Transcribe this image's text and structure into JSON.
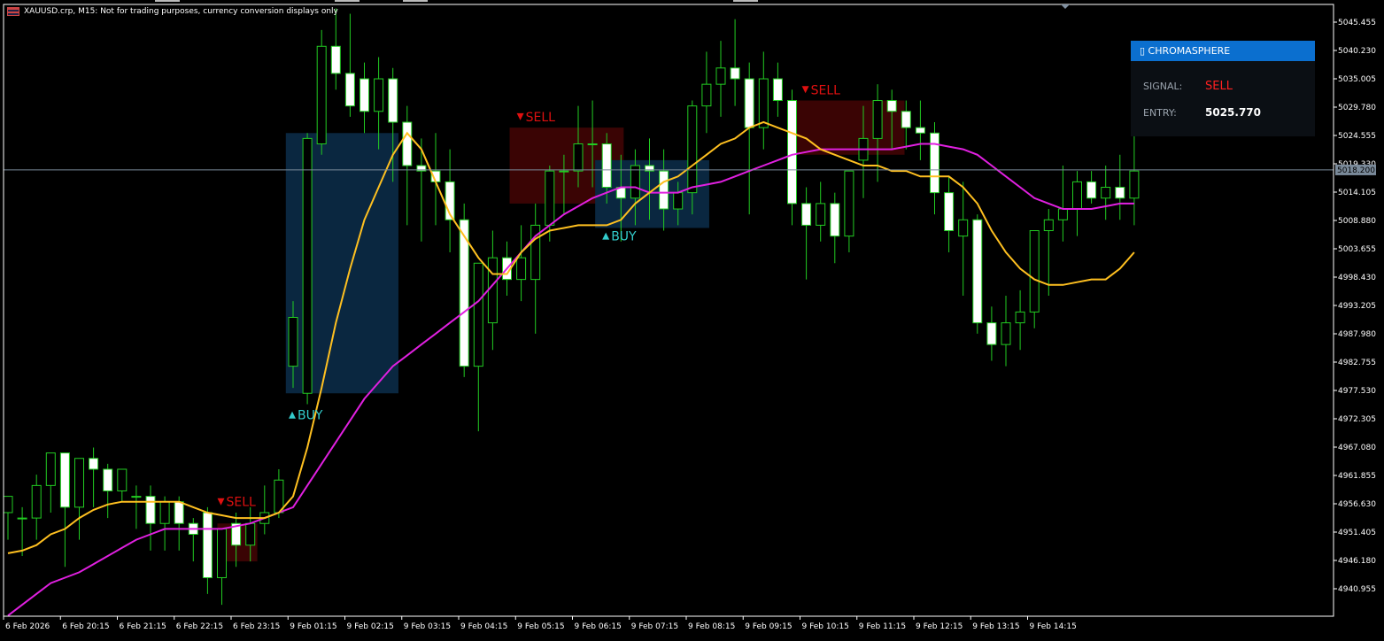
{
  "header": {
    "symbol_info": "XAUUSD.crp, M15:  Not for trading purposes, currency conversion displays only"
  },
  "panel": {
    "title": "▯ CHROMASPHERE",
    "signal_label": "SIGNAL:",
    "signal_value": "SELL",
    "entry_label": "ENTRY:",
    "entry_value": "5025.770"
  },
  "price_axis": [
    "5045.455",
    "5040.230",
    "5035.005",
    "5029.780",
    "5024.555",
    "5019.330",
    "5014.105",
    "5008.880",
    "5003.655",
    "4998.430",
    "4993.205",
    "4987.980",
    "4982.755",
    "4977.530",
    "4972.305",
    "4967.080",
    "4961.855",
    "4956.630",
    "4951.405",
    "4946.180",
    "4940.955"
  ],
  "current_price": "5018.200",
  "time_axis": [
    "6 Feb 2026",
    "6 Feb 20:15",
    "6 Feb 21:15",
    "6 Feb 22:15",
    "6 Feb 23:15",
    "9 Feb 01:15",
    "9 Feb 02:15",
    "9 Feb 03:15",
    "9 Feb 04:15",
    "9 Feb 05:15",
    "9 Feb 06:15",
    "9 Feb 07:15",
    "9 Feb 08:15",
    "9 Feb 09:15",
    "9 Feb 10:15",
    "9 Feb 11:15",
    "9 Feb 12:15",
    "9 Feb 13:15",
    "9 Feb 14:15"
  ],
  "signals": [
    {
      "type": "SELL",
      "label": "SELL"
    },
    {
      "type": "BUY",
      "label": "BUY"
    },
    {
      "type": "SELL",
      "label": "SELL"
    },
    {
      "type": "BUY",
      "label": "BUY"
    },
    {
      "type": "SELL",
      "label": "SELL"
    }
  ],
  "colors": {
    "bull_candle": "#000000",
    "bear_candle": "#ffffff",
    "wick": "#22cc22",
    "fast_ma": "#ffc020",
    "slow_ma": "#e020e0",
    "buy": "#33cccc",
    "sell": "#e01010",
    "buy_zone": "#0a2740",
    "sell_zone": "#3a0404"
  },
  "chart_data": {
    "type": "candlestick",
    "symbol": "XAUUSD.crp",
    "timeframe": "M15",
    "ylim": [
      4936,
      5049
    ],
    "candles": [
      {
        "o": 4955,
        "h": 4958,
        "l": 4950,
        "c": 4958
      },
      {
        "o": 4954,
        "h": 4956,
        "l": 4947,
        "c": 4954
      },
      {
        "o": 4954,
        "h": 4962,
        "l": 4950,
        "c": 4960
      },
      {
        "o": 4960,
        "h": 4966,
        "l": 4955,
        "c": 4966
      },
      {
        "o": 4966,
        "h": 4966,
        "l": 4945,
        "c": 4956
      },
      {
        "o": 4956,
        "h": 4965,
        "l": 4950,
        "c": 4965
      },
      {
        "o": 4965,
        "h": 4967,
        "l": 4956,
        "c": 4963
      },
      {
        "o": 4963,
        "h": 4964,
        "l": 4954,
        "c": 4959
      },
      {
        "o": 4959,
        "h": 4963,
        "l": 4957,
        "c": 4963
      },
      {
        "o": 4958,
        "h": 4960,
        "l": 4952,
        "c": 4958
      },
      {
        "o": 4958,
        "h": 4960,
        "l": 4948,
        "c": 4953
      },
      {
        "o": 4953,
        "h": 4958,
        "l": 4948,
        "c": 4957
      },
      {
        "o": 4957,
        "h": 4958,
        "l": 4948,
        "c": 4953
      },
      {
        "o": 4953,
        "h": 4954,
        "l": 4946,
        "c": 4951
      },
      {
        "o": 4955,
        "h": 4956,
        "l": 4940,
        "c": 4943
      },
      {
        "o": 4943,
        "h": 4950,
        "l": 4938,
        "c": 4952
      },
      {
        "o": 4953,
        "h": 4955,
        "l": 4945,
        "c": 4949
      },
      {
        "o": 4949,
        "h": 4956,
        "l": 4946,
        "c": 4953
      },
      {
        "o": 4953,
        "h": 4960,
        "l": 4951,
        "c": 4955
      },
      {
        "o": 4955,
        "h": 4963,
        "l": 4954,
        "c": 4961
      },
      {
        "o": 4982,
        "h": 4994,
        "l": 4978,
        "c": 4991
      },
      {
        "o": 4977,
        "h": 5025,
        "l": 4975,
        "c": 5024
      },
      {
        "o": 5023,
        "h": 5044,
        "l": 5021,
        "c": 5041
      },
      {
        "o": 5041,
        "h": 5048,
        "l": 5033,
        "c": 5036
      },
      {
        "o": 5036,
        "h": 5047,
        "l": 5028,
        "c": 5030
      },
      {
        "o": 5035,
        "h": 5038,
        "l": 5025,
        "c": 5029
      },
      {
        "o": 5029,
        "h": 5039,
        "l": 5022,
        "c": 5035
      },
      {
        "o": 5035,
        "h": 5037,
        "l": 5016,
        "c": 5027
      },
      {
        "o": 5027,
        "h": 5030,
        "l": 5008,
        "c": 5019
      },
      {
        "o": 5019,
        "h": 5024,
        "l": 5005,
        "c": 5018
      },
      {
        "o": 5018,
        "h": 5025,
        "l": 5008,
        "c": 5016
      },
      {
        "o": 5016,
        "h": 5022,
        "l": 5003,
        "c": 5009
      },
      {
        "o": 5009,
        "h": 5012,
        "l": 4980,
        "c": 4982
      },
      {
        "o": 4982,
        "h": 5001,
        "l": 4970,
        "c": 5001
      },
      {
        "o": 4990,
        "h": 5007,
        "l": 4985,
        "c": 5002
      },
      {
        "o": 5002,
        "h": 5005,
        "l": 4995,
        "c": 4998
      },
      {
        "o": 4998,
        "h": 5008,
        "l": 4994,
        "c": 5002
      },
      {
        "o": 4998,
        "h": 5012,
        "l": 4988,
        "c": 5008
      },
      {
        "o": 5008,
        "h": 5019,
        "l": 5005,
        "c": 5018
      },
      {
        "o": 5018,
        "h": 5021,
        "l": 5010,
        "c": 5018
      },
      {
        "o": 5018,
        "h": 5030,
        "l": 5015,
        "c": 5023
      },
      {
        "o": 5023,
        "h": 5031,
        "l": 5015,
        "c": 5023
      },
      {
        "o": 5023,
        "h": 5025,
        "l": 5012,
        "c": 5015
      },
      {
        "o": 5015,
        "h": 5021,
        "l": 5005,
        "c": 5013
      },
      {
        "o": 5013,
        "h": 5022,
        "l": 5008,
        "c": 5019
      },
      {
        "o": 5019,
        "h": 5024,
        "l": 5009,
        "c": 5018
      },
      {
        "o": 5018,
        "h": 5022,
        "l": 5007,
        "c": 5011
      },
      {
        "o": 5011,
        "h": 5016,
        "l": 5008,
        "c": 5014
      },
      {
        "o": 5014,
        "h": 5031,
        "l": 5010,
        "c": 5030
      },
      {
        "o": 5030,
        "h": 5040,
        "l": 5025,
        "c": 5034
      },
      {
        "o": 5034,
        "h": 5042,
        "l": 5028,
        "c": 5037
      },
      {
        "o": 5037,
        "h": 5046,
        "l": 5030,
        "c": 5035
      },
      {
        "o": 5035,
        "h": 5038,
        "l": 5010,
        "c": 5026
      },
      {
        "o": 5026,
        "h": 5040,
        "l": 5022,
        "c": 5035
      },
      {
        "o": 5035,
        "h": 5038,
        "l": 5028,
        "c": 5031
      },
      {
        "o": 5031,
        "h": 5033,
        "l": 5008,
        "c": 5012
      },
      {
        "o": 5012,
        "h": 5015,
        "l": 4998,
        "c": 5008
      },
      {
        "o": 5008,
        "h": 5016,
        "l": 5005,
        "c": 5012
      },
      {
        "o": 5012,
        "h": 5014,
        "l": 5001,
        "c": 5006
      },
      {
        "o": 5006,
        "h": 5018,
        "l": 5003,
        "c": 5018
      },
      {
        "o": 5020,
        "h": 5030,
        "l": 5013,
        "c": 5024
      },
      {
        "o": 5024,
        "h": 5034,
        "l": 5016,
        "c": 5031
      },
      {
        "o": 5031,
        "h": 5033,
        "l": 5022,
        "c": 5029
      },
      {
        "o": 5029,
        "h": 5031,
        "l": 5022,
        "c": 5026
      },
      {
        "o": 5026,
        "h": 5031,
        "l": 5020,
        "c": 5025
      },
      {
        "o": 5025,
        "h": 5027,
        "l": 5010,
        "c": 5014
      },
      {
        "o": 5014,
        "h": 5017,
        "l": 5003,
        "c": 5007
      },
      {
        "o": 5006,
        "h": 5016,
        "l": 4995,
        "c": 5009
      },
      {
        "o": 5009,
        "h": 5010,
        "l": 4988,
        "c": 4990
      },
      {
        "o": 4990,
        "h": 4993,
        "l": 4983,
        "c": 4986
      },
      {
        "o": 4986,
        "h": 4995,
        "l": 4982,
        "c": 4990
      },
      {
        "o": 4990,
        "h": 4996,
        "l": 4985,
        "c": 4992
      },
      {
        "o": 4992,
        "h": 5004,
        "l": 4989,
        "c": 5007
      },
      {
        "o": 5007,
        "h": 5011,
        "l": 4995,
        "c": 5009
      },
      {
        "o": 5009,
        "h": 5019,
        "l": 5005,
        "c": 5011
      },
      {
        "o": 5011,
        "h": 5018,
        "l": 5006,
        "c": 5016
      },
      {
        "o": 5016,
        "h": 5018,
        "l": 5012,
        "c": 5013
      },
      {
        "o": 5013,
        "h": 5019,
        "l": 5009,
        "c": 5015
      },
      {
        "o": 5015,
        "h": 5021,
        "l": 5009,
        "c": 5013
      },
      {
        "o": 5013,
        "h": 5025,
        "l": 5008,
        "c": 5018
      }
    ],
    "fast_ma": [
      4947.5,
      4948,
      4949,
      4951,
      4952,
      4954,
      4955.5,
      4956.5,
      4957,
      4957,
      4957,
      4957,
      4957,
      4956,
      4955,
      4954.5,
      4954,
      4954,
      4954,
      4955,
      4958,
      4967,
      4978,
      4990,
      5000,
      5009,
      5015,
      5021,
      5025,
      5022,
      5016,
      5010,
      5006,
      5002,
      4999,
      4999,
      5003,
      5005.5,
      5007,
      5007.5,
      5008,
      5008,
      5008,
      5009,
      5012,
      5014,
      5016,
      5017,
      5019,
      5021,
      5023,
      5024,
      5026,
      5027,
      5026,
      5025,
      5024,
      5022,
      5021,
      5020,
      5019,
      5019,
      5018,
      5018,
      5017,
      5017,
      5017,
      5015,
      5012,
      5007,
      5003,
      5000,
      4998,
      4997,
      4997,
      4997.5,
      4998,
      4998,
      5000,
      5003
    ],
    "slow_ma": [
      4936,
      4938,
      4940,
      4942,
      4943,
      4944,
      4945.5,
      4947,
      4948.5,
      4950,
      4951,
      4952,
      4952,
      4952,
      4952,
      4952,
      4952.5,
      4953,
      4954,
      4955,
      4956,
      4960,
      4964,
      4968,
      4972,
      4976,
      4979,
      4982,
      4984,
      4986,
      4988,
      4990,
      4992,
      4994,
      4997,
      5000,
      5003,
      5006,
      5008,
      5010,
      5011.5,
      5013,
      5014,
      5015,
      5015,
      5014,
      5014,
      5014,
      5015,
      5015.5,
      5016,
      5017,
      5018,
      5019,
      5020,
      5021,
      5021.5,
      5022,
      5022,
      5022,
      5022,
      5022,
      5022,
      5022.5,
      5023,
      5023,
      5022.5,
      5022,
      5021,
      5019,
      5017,
      5015,
      5013,
      5012,
      5011,
      5011,
      5011,
      5011.5,
      5012,
      5012
    ]
  }
}
